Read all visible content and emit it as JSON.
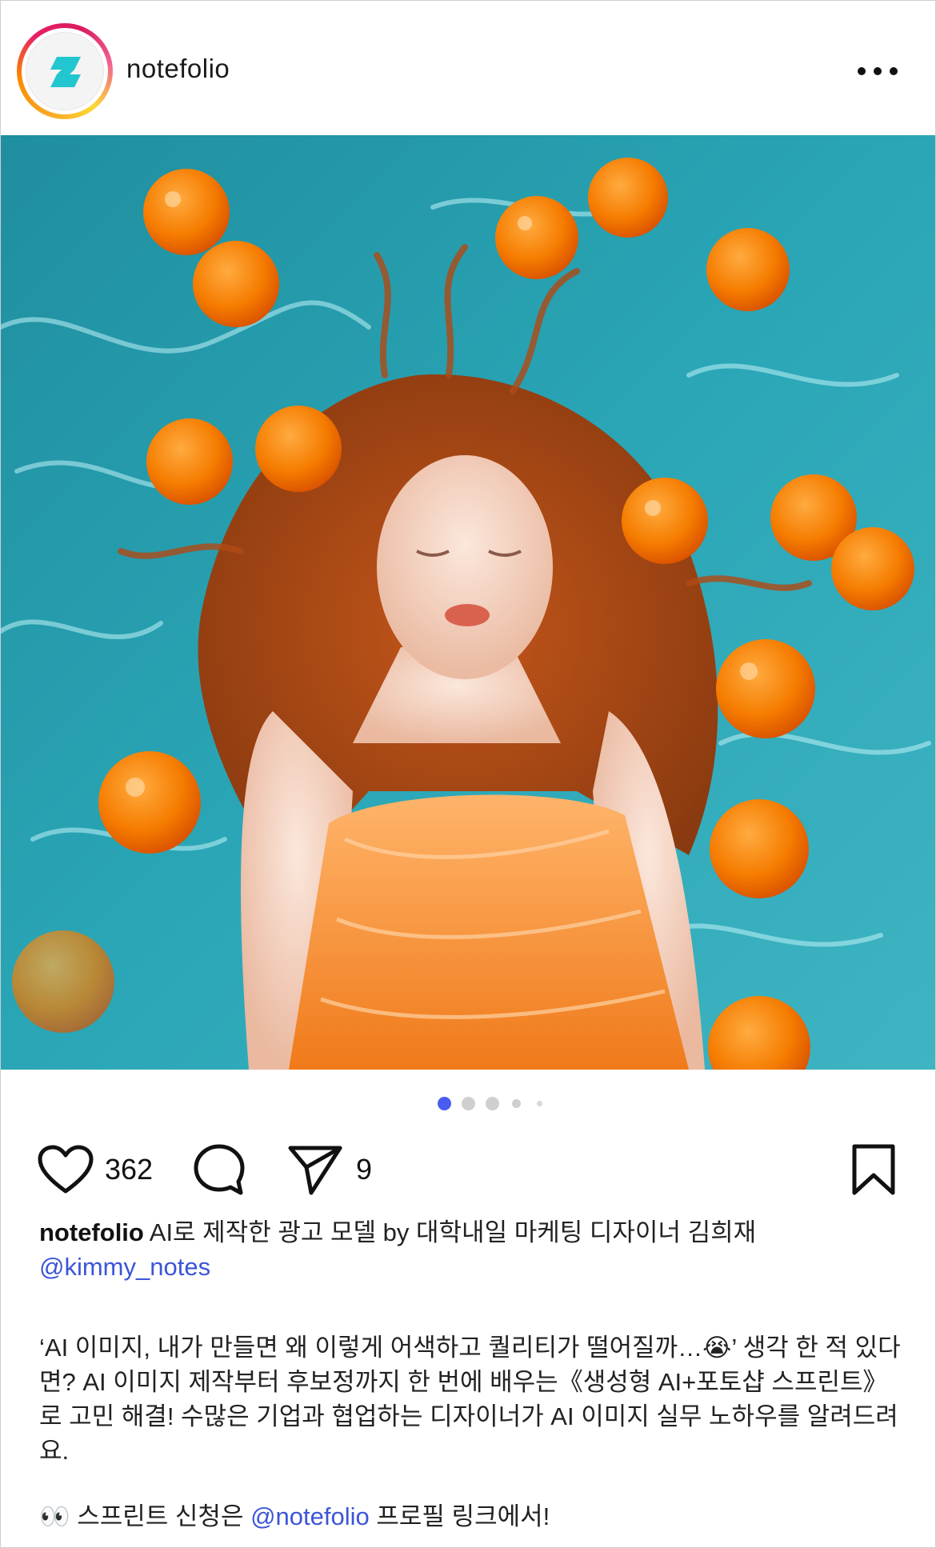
{
  "header": {
    "username": "notefolio",
    "avatar_icon": "notefolio-logo-icon",
    "more_icon": "more-horizontal-icon"
  },
  "post": {
    "image_icon": "post-photo",
    "carousel": {
      "total": 5,
      "active_index": 0,
      "accent": "#4a5cf0"
    }
  },
  "actions": {
    "like_icon": "heart-icon",
    "like_count": "362",
    "comment_icon": "comment-icon",
    "share_icon": "send-icon",
    "share_count": "9",
    "save_icon": "bookmark-icon"
  },
  "caption": {
    "username": "notefolio",
    "title": " AI로 제작한 광고 모델 by 대학내일 마케팅 디자이너 김희재",
    "mention": "@kimmy_notes",
    "body": "‘AI 이미지, 내가 만들면 왜 이렇게 어색하고 퀄리티가 떨어질까…😭’ 생각 한 적 있다면? AI 이미지 제작부터 후보정까지 한 번에 배우는《생성형 AI+포토샵 스프린트》로 고민 해결! 수많은 기업과 협업하는 디자이너가 AI 이미지 실무 노하우를 알려드려요.",
    "cta_prefix": "👀 스프린트 신청은 ",
    "cta_mention": "@notefolio",
    "cta_suffix": " 프로필 링크에서!",
    "mention_color": "#3d55d6"
  }
}
